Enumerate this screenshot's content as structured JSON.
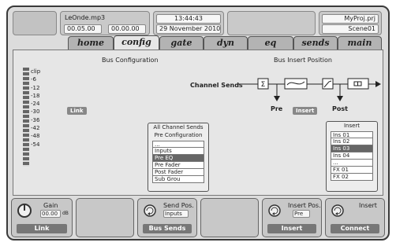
{
  "header": {
    "song": "LeOnde.mp3",
    "time_pos": "00.05.00",
    "time_len": "00.00.00",
    "clock": "13:44:43",
    "date": "29 November 2010",
    "project": "MyProj.prj",
    "scene": "Scene01"
  },
  "tabs": [
    "home",
    "config",
    "gate",
    "dyn",
    "eq",
    "sends",
    "main"
  ],
  "bus_config": {
    "title": "Bus Configuration",
    "meter_labels": [
      "clip",
      "-6",
      "-12",
      "-18",
      "-24",
      "-30",
      "-36",
      "-42",
      "-48",
      "-54"
    ],
    "link_badge": "Link"
  },
  "bus_insert": {
    "title": "Bus Insert Position",
    "channel_sends": "Channel Sends",
    "pre": "Pre",
    "insert_badge": "Insert",
    "post": "Post"
  },
  "send_list": {
    "title_line1": "All Channel Sends",
    "title_line2": "Pre Configuration",
    "options": [
      "...",
      "Inputs",
      "Pre EQ",
      "Pre Fader",
      "Post Fader",
      "Sub Grou"
    ],
    "selected": "Pre EQ"
  },
  "insert_list": {
    "title": "Insert",
    "options": [
      "Ins 01",
      "Ins 02",
      "Ins 03",
      "Ins 04",
      "...",
      "FX 01",
      "FX 02"
    ],
    "selected": "Ins 03"
  },
  "footer": {
    "gain_label": "Gain",
    "gain_value": "00.00",
    "gain_unit": "dB",
    "link": "Link",
    "send_pos_label": "Send Pos.",
    "send_pos_value": "Inputs",
    "bus_sends": "Bus Sends",
    "insert_pos_label": "Insert Pos.",
    "insert_pos_value": "Pre",
    "insert": "Insert",
    "insert_label": "Insert",
    "connect": "Connect"
  }
}
